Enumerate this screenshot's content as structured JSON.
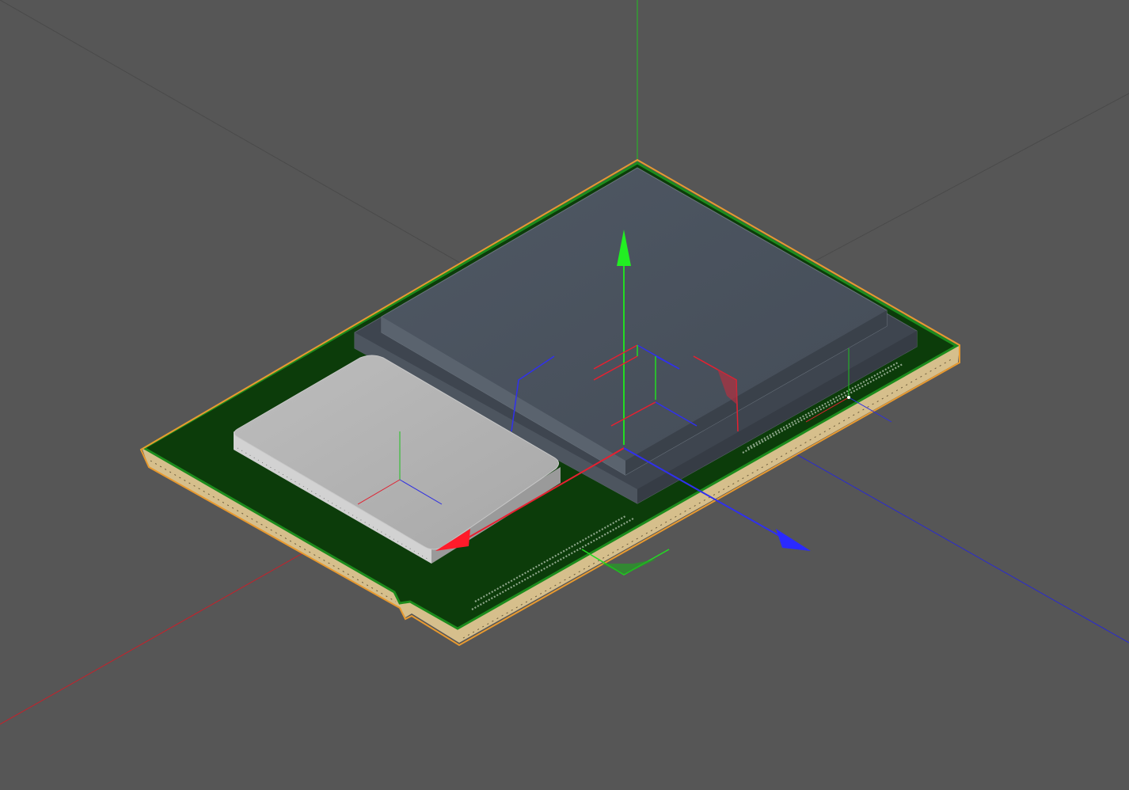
{
  "viewport": {
    "background": "#565656",
    "grid_color": "#4a4a4a",
    "axis_x_color": "#c8202a",
    "axis_z_color": "#2a2ad0",
    "axis_y_color": "#20c020"
  },
  "scene": {
    "selected_object": "cpu-package",
    "selection_outline_color": "#e89a30",
    "substrate_color": "#0c3c0a",
    "substrate_edge_color": "#d8c08a",
    "heat_spreader_color": "#4a525c",
    "die_color": "#b4b4b4"
  },
  "gizmo": {
    "mode": "universal-transform",
    "handles": [
      "move-x",
      "move-y",
      "move-z",
      "rotate-x",
      "rotate-y",
      "rotate-z",
      "scale-x",
      "scale-y",
      "scale-z"
    ]
  }
}
